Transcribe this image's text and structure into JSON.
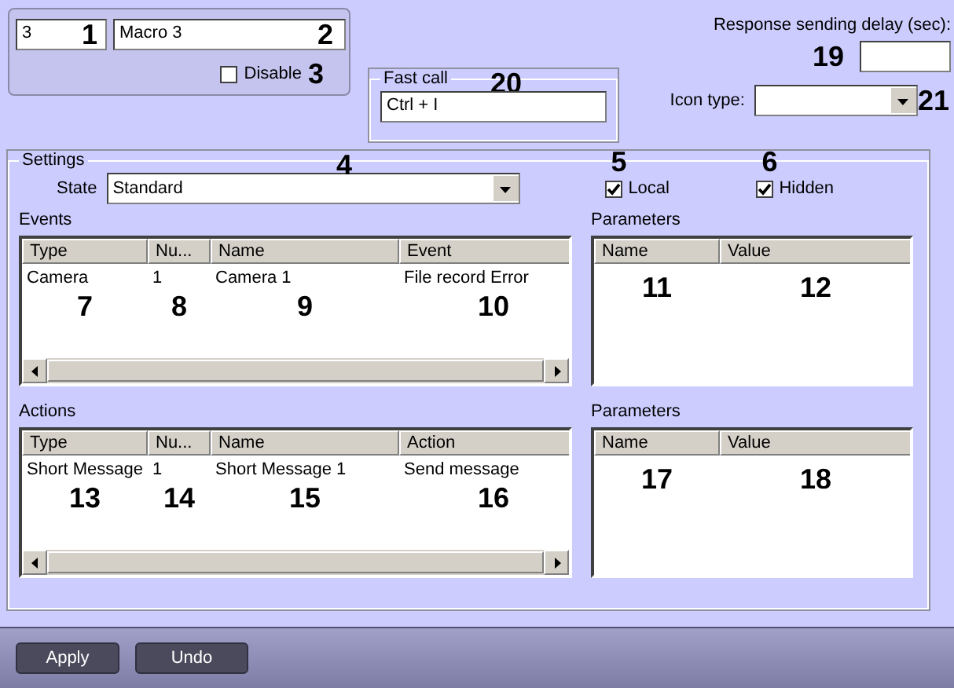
{
  "header": {
    "id_field": {
      "value": "3",
      "callout": "1"
    },
    "name_field": {
      "value": "Macro 3",
      "callout": "2"
    },
    "disable": {
      "label": "Disable",
      "checked": false,
      "callout": "3"
    }
  },
  "fast_call": {
    "legend": "Fast call",
    "value": "Ctrl + I",
    "callout": "20"
  },
  "response_delay": {
    "label": "Response sending delay (sec):",
    "callout": "19"
  },
  "icon_type": {
    "label": "Icon type:",
    "callout": "21"
  },
  "settings": {
    "legend": "Settings",
    "callout": "4",
    "state": {
      "label": "State",
      "value": "Standard"
    },
    "options": [
      {
        "label": "Local",
        "checked": true,
        "callout": "5"
      },
      {
        "label": "Hidden",
        "checked": true,
        "callout": "6"
      }
    ],
    "panels": [
      {
        "title": "Events",
        "columns": [
          {
            "label": "Type",
            "callout": "7"
          },
          {
            "label": "Nu...",
            "callout": "8"
          },
          {
            "label": "Name",
            "callout": "9"
          },
          {
            "label": "Event",
            "callout": "10"
          }
        ],
        "rows": [
          [
            "Camera",
            "1",
            "Camera 1",
            "File record Error"
          ]
        ],
        "params": {
          "title": "Parameters",
          "columns": [
            {
              "label": "Name",
              "callout": "11"
            },
            {
              "label": "Value",
              "callout": "12"
            }
          ]
        }
      },
      {
        "title": "Actions",
        "columns": [
          {
            "label": "Type",
            "callout": "13"
          },
          {
            "label": "Nu...",
            "callout": "14"
          },
          {
            "label": "Name",
            "callout": "15"
          },
          {
            "label": "Action",
            "callout": "16"
          }
        ],
        "rows": [
          [
            "Short Message",
            "1",
            "Short Message 1",
            "Send message"
          ]
        ],
        "params": {
          "title": "Parameters",
          "columns": [
            {
              "label": "Name",
              "callout": "17"
            },
            {
              "label": "Value",
              "callout": "18"
            }
          ]
        }
      }
    ]
  },
  "buttons": [
    {
      "label": "Apply"
    },
    {
      "label": "Undo"
    }
  ]
}
